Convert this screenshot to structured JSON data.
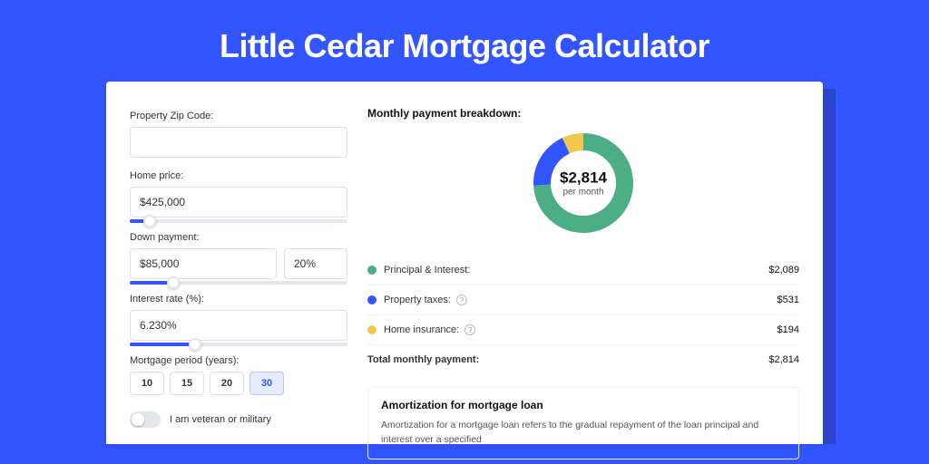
{
  "page_title": "Little Cedar Mortgage Calculator",
  "colors": {
    "green": "#4cae85",
    "blue": "#3355ff",
    "yellow": "#f2c84b"
  },
  "form": {
    "zip_label": "Property Zip Code:",
    "zip_value": "",
    "home_price_label": "Home price:",
    "home_price_value": "$425,000",
    "home_price_slider_pct": 9,
    "down_payment_label": "Down payment:",
    "down_payment_value": "$85,000",
    "down_payment_pct_value": "20%",
    "down_payment_slider_pct": 20,
    "interest_label": "Interest rate (%):",
    "interest_value": "6.230%",
    "interest_slider_pct": 30,
    "period_label": "Mortgage period (years):",
    "period_options": [
      "10",
      "15",
      "20",
      "30"
    ],
    "period_selected_index": 3,
    "veteran_label": "I am veteran or military",
    "veteran_on": false
  },
  "breakdown": {
    "title": "Monthly payment breakdown:",
    "center_value": "$2,814",
    "center_sub": "per month",
    "items": [
      {
        "label": "Principal & Interest:",
        "amount": "$2,089",
        "color_key": "green",
        "info": false
      },
      {
        "label": "Property taxes:",
        "amount": "$531",
        "color_key": "blue",
        "info": true
      },
      {
        "label": "Home insurance:",
        "amount": "$194",
        "color_key": "yellow",
        "info": true
      }
    ],
    "total_label": "Total monthly payment:",
    "total_amount": "$2,814"
  },
  "chart_data": {
    "type": "pie",
    "title": "Monthly payment breakdown",
    "center_label": "$2,814 per month",
    "series": [
      {
        "name": "Principal & Interest",
        "value": 2089,
        "color": "#4cae85"
      },
      {
        "name": "Property taxes",
        "value": 531,
        "color": "#3355ff"
      },
      {
        "name": "Home insurance",
        "value": 194,
        "color": "#f2c84b"
      }
    ],
    "total": 2814
  },
  "amortization": {
    "title": "Amortization for mortgage loan",
    "body": "Amortization for a mortgage loan refers to the gradual repayment of the loan principal and interest over a specified"
  }
}
